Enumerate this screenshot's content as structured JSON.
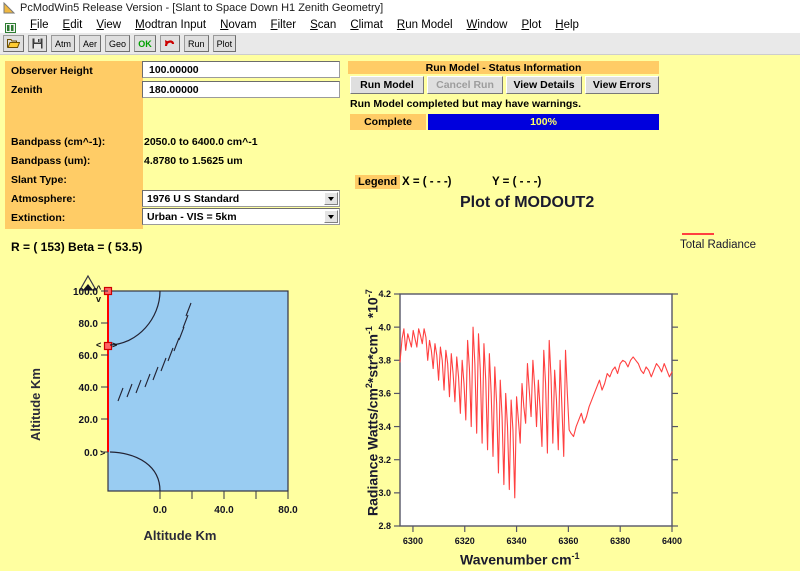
{
  "window": {
    "title": "PcModWin5 Release Version  - [Slant to Space Down H1 Zenith Geometry]",
    "icon": "app-icon"
  },
  "menu": {
    "items": [
      {
        "label": "File"
      },
      {
        "label": "Edit"
      },
      {
        "label": "View"
      },
      {
        "label": "Modtran Input"
      },
      {
        "label": "Novam"
      },
      {
        "label": "Filter"
      },
      {
        "label": "Scan"
      },
      {
        "label": "Climat"
      },
      {
        "label": "Run Model"
      },
      {
        "label": "Window"
      },
      {
        "label": "Plot"
      },
      {
        "label": "Help"
      }
    ]
  },
  "toolbar": {
    "buttons": [
      {
        "name": "open-file-button",
        "label": "",
        "icon": "folder-open-icon"
      },
      {
        "name": "save-file-button",
        "label": "",
        "icon": "floppy-disk-icon"
      },
      {
        "name": "atmosphere-button",
        "label": "Atm",
        "icon": ""
      },
      {
        "name": "aerosol-button",
        "label": "Aer",
        "icon": ""
      },
      {
        "name": "geometry-button",
        "label": "Geo",
        "icon": ""
      },
      {
        "name": "ok-button",
        "label": "OK",
        "icon": ""
      },
      {
        "name": "undo-button",
        "label": "",
        "icon": "undo-arrow-icon"
      },
      {
        "name": "run-button",
        "label": "Run",
        "icon": ""
      },
      {
        "name": "plot-button",
        "label": "Plot",
        "icon": ""
      }
    ]
  },
  "parameters": {
    "observer_height": {
      "label": "Observer Height",
      "value": "100.00000"
    },
    "zenith": {
      "label": "Zenith",
      "value": "180.00000"
    },
    "bandpass_cm": {
      "label": "Bandpass (cm^-1):",
      "value": "2050.0 to 6400.0 cm^-1"
    },
    "bandpass_um": {
      "label": "Bandpass (um):",
      "value": "4.8780 to 1.5625 um"
    },
    "slant_type": {
      "label": "Slant Type:",
      "value": ""
    },
    "atmosphere": {
      "label": "Atmosphere:",
      "value": "1976 U S Standard"
    },
    "extinction": {
      "label": "Extinction:",
      "value": "Urban - VIS = 5km"
    }
  },
  "status": {
    "title": "Run Model - Status Information",
    "buttons": [
      {
        "name": "run-model-button",
        "label": "Run Model",
        "enabled": true
      },
      {
        "name": "cancel-run-button",
        "label": "Cancel Run",
        "enabled": false
      },
      {
        "name": "view-details-button",
        "label": "View Details",
        "enabled": true
      },
      {
        "name": "view-errors-button",
        "label": "View Errors",
        "enabled": true
      }
    ],
    "message": "Run Model completed but may have warnings.",
    "state_label": "Complete",
    "progress_text": "100%",
    "progress_percent": 100,
    "progress_color": "#0000dd"
  },
  "legend_bar": {
    "tag": "Legend",
    "x_readout": "X = (    - - -)",
    "y_readout": "Y = (    - - -)",
    "plot_title": "Plot of MODOUT2"
  },
  "geometry": {
    "r_beta_text": "R = (      153) Beta = (     53.5)",
    "r_value": "153",
    "beta_value": "53.5",
    "ylabel": "Altitude Km",
    "xlabel": "Altitude Km",
    "yticks": [
      "100.0",
      "80.0",
      "60.0",
      "40.0",
      "20.0",
      "0.0"
    ],
    "xticks": [
      "0.0",
      "40.0",
      "80.0"
    ],
    "observer_marker_altitude": "100.0",
    "tangent_marker_altitude": "60.0",
    "fill_color": "#99ccf2",
    "path_color": "#ff0000"
  },
  "chart_data": {
    "type": "line",
    "title": "Plot of MODOUT2",
    "xlabel": "Wavenumber cm",
    "xlabel_sup": "-1",
    "ylabel": "Radiance Watts/cm²*str*cm⁻¹  *10⁻⁷",
    "ylabel_parts": {
      "main": "Radiance Watts/cm",
      "sup1": "2",
      "mid": "*str*cm",
      "sup2": "-1",
      "scale": "*10",
      "sup3": "-7"
    },
    "xlim": [
      6295,
      6400
    ],
    "ylim": [
      2.8,
      4.2
    ],
    "xticks": [
      6300,
      6320,
      6340,
      6360,
      6380,
      6400
    ],
    "xtick_labels": [
      "6300",
      "6320",
      "6340",
      "6360",
      "6380",
      "6400"
    ],
    "yticks": [
      2.8,
      3.0,
      3.2,
      3.4,
      3.6,
      3.8,
      4.0,
      4.2
    ],
    "ytick_labels": [
      "2.8",
      "3.0",
      "3.2",
      "3.4",
      "3.6",
      "3.8",
      "4.0",
      "4.2"
    ],
    "grid": false,
    "legend_position": "right",
    "series": [
      {
        "name": "Total Radiance",
        "color": "#ff4040",
        "x": [
          6295.0,
          6295.8,
          6296.5,
          6297.2,
          6298.0,
          6298.7,
          6299.4,
          6300.1,
          6300.8,
          6301.5,
          6302.2,
          6302.9,
          6303.6,
          6304.3,
          6305.0,
          6305.7,
          6306.4,
          6307.1,
          6307.8,
          6308.5,
          6309.2,
          6309.9,
          6310.6,
          6311.3,
          6312.0,
          6312.7,
          6313.4,
          6314.1,
          6314.8,
          6315.5,
          6316.2,
          6316.9,
          6317.6,
          6318.3,
          6319.0,
          6319.7,
          6320.4,
          6321.1,
          6321.8,
          6322.5,
          6323.2,
          6323.9,
          6324.6,
          6325.3,
          6326.0,
          6326.7,
          6327.4,
          6328.1,
          6328.8,
          6329.5,
          6330.2,
          6330.9,
          6331.6,
          6332.3,
          6333.0,
          6333.7,
          6334.4,
          6335.1,
          6335.8,
          6336.5,
          6337.2,
          6337.9,
          6338.6,
          6339.3,
          6340.0,
          6340.7,
          6341.4,
          6342.1,
          6342.8,
          6343.5,
          6344.2,
          6344.9,
          6345.6,
          6346.3,
          6347.0,
          6347.7,
          6348.4,
          6349.1,
          6349.8,
          6350.5,
          6351.2,
          6351.9,
          6352.6,
          6353.3,
          6354.0,
          6354.7,
          6355.4,
          6356.1,
          6356.8,
          6357.5,
          6358.2,
          6358.9,
          6359.6,
          6360.3,
          6361.0,
          6362.0,
          6363.0,
          6364.0,
          6365.0,
          6366.0,
          6367.0,
          6368.0,
          6369.0,
          6370.0,
          6371.0,
          6372.0,
          6373.0,
          6374.0,
          6375.0,
          6376.0,
          6377.0,
          6378.0,
          6379.0,
          6380.0,
          6381.0,
          6382.0,
          6383.0,
          6384.0,
          6385.0,
          6386.0,
          6387.0,
          6388.0,
          6389.0,
          6390.0,
          6391.0,
          6392.0,
          6393.0,
          6394.0,
          6395.0,
          6396.0,
          6397.0,
          6398.0,
          6399.0,
          6400.0
        ],
        "y": [
          3.79,
          3.93,
          3.99,
          3.86,
          3.96,
          3.92,
          3.88,
          3.98,
          3.93,
          3.88,
          3.99,
          3.95,
          3.9,
          3.99,
          3.94,
          3.8,
          3.92,
          3.86,
          3.75,
          3.9,
          3.83,
          3.68,
          3.88,
          3.8,
          3.62,
          3.86,
          3.78,
          3.58,
          3.84,
          3.72,
          3.55,
          3.82,
          3.7,
          3.48,
          3.8,
          3.66,
          3.44,
          3.92,
          3.75,
          3.4,
          4.0,
          3.78,
          3.36,
          3.96,
          3.74,
          3.3,
          3.9,
          3.68,
          3.26,
          3.84,
          3.6,
          3.22,
          3.76,
          3.54,
          3.12,
          3.68,
          3.46,
          3.05,
          3.6,
          3.4,
          3.02,
          3.56,
          3.38,
          2.97,
          3.58,
          3.44,
          3.3,
          3.66,
          3.52,
          3.42,
          3.78,
          3.62,
          3.46,
          3.8,
          3.64,
          3.4,
          3.68,
          3.5,
          3.28,
          3.86,
          3.66,
          3.24,
          3.92,
          3.7,
          3.3,
          3.74,
          3.56,
          3.26,
          3.8,
          3.52,
          3.22,
          3.86,
          3.6,
          3.38,
          3.36,
          3.34,
          3.4,
          3.44,
          3.48,
          3.42,
          3.46,
          3.52,
          3.56,
          3.6,
          3.64,
          3.68,
          3.62,
          3.66,
          3.72,
          3.7,
          3.74,
          3.76,
          3.72,
          3.78,
          3.8,
          3.79,
          3.76,
          3.8,
          3.82,
          3.8,
          3.78,
          3.74,
          3.72,
          3.76,
          3.74,
          3.7,
          3.74,
          3.78,
          3.76,
          3.73,
          3.78,
          3.74,
          3.7,
          3.73
        ]
      }
    ]
  }
}
